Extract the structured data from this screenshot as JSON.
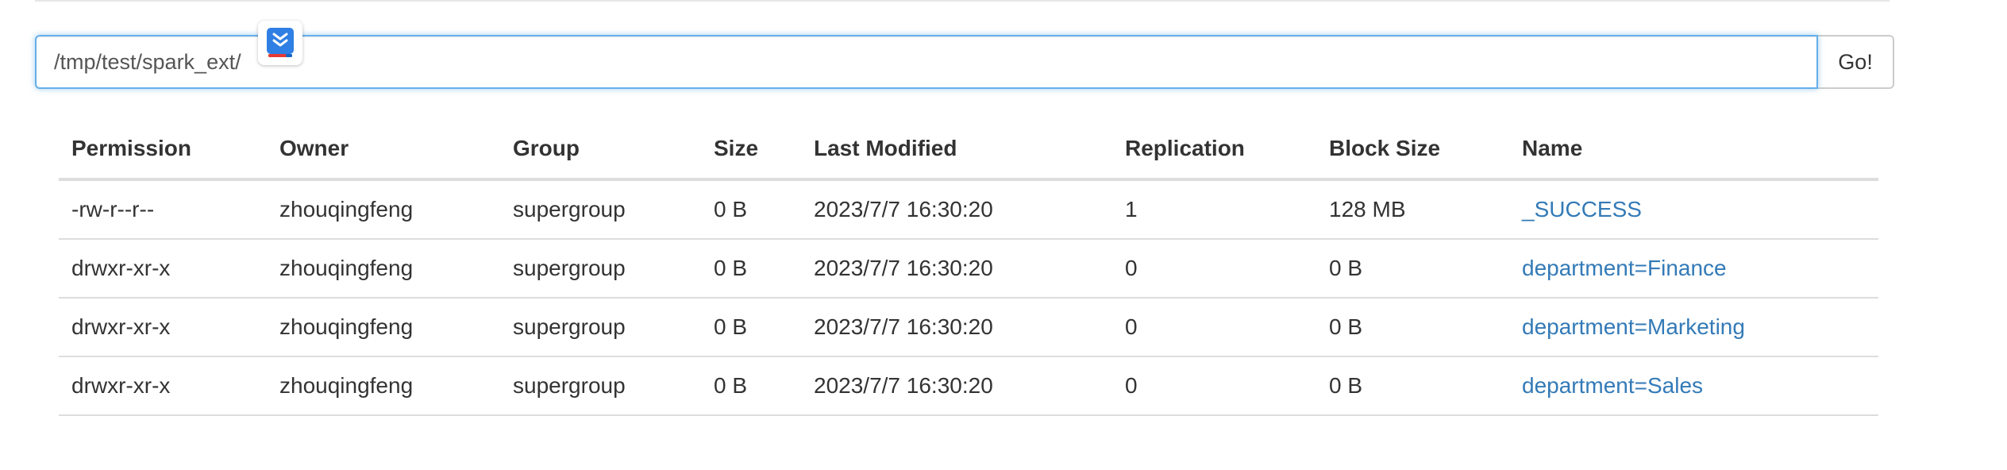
{
  "path_bar": {
    "value": "/tmp/test/spark_ext/",
    "go_label": "Go!"
  },
  "table": {
    "columns": [
      "Permission",
      "Owner",
      "Group",
      "Size",
      "Last Modified",
      "Replication",
      "Block Size",
      "Name"
    ],
    "rows": [
      {
        "permission": "-rw-r--r--",
        "owner": "zhouqingfeng",
        "group": "supergroup",
        "size": "0 B",
        "modified": "2023/7/7 16:30:20",
        "replication": "1",
        "block_size": "128 MB",
        "name": "_SUCCESS"
      },
      {
        "permission": "drwxr-xr-x",
        "owner": "zhouqingfeng",
        "group": "supergroup",
        "size": "0 B",
        "modified": "2023/7/7 16:30:20",
        "replication": "0",
        "block_size": "0 B",
        "name": "department=Finance"
      },
      {
        "permission": "drwxr-xr-x",
        "owner": "zhouqingfeng",
        "group": "supergroup",
        "size": "0 B",
        "modified": "2023/7/7 16:30:20",
        "replication": "0",
        "block_size": "0 B",
        "name": "department=Marketing"
      },
      {
        "permission": "drwxr-xr-x",
        "owner": "zhouqingfeng",
        "group": "supergroup",
        "size": "0 B",
        "modified": "2023/7/7 16:30:20",
        "replication": "0",
        "block_size": "0 B",
        "name": "department=Sales"
      }
    ]
  },
  "icons": {
    "extension": "browser-extension-icon"
  },
  "colors": {
    "link": "#337ab7",
    "focus_border": "#66afe9"
  }
}
